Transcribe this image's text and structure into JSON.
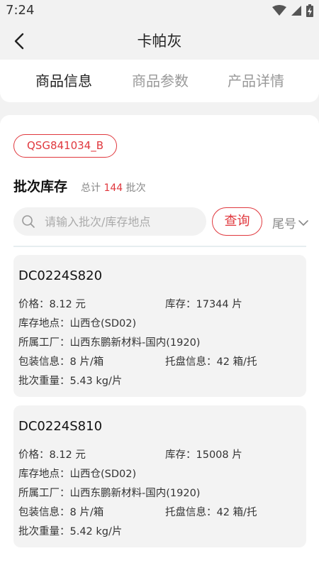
{
  "status_bar": {
    "time": "7:24"
  },
  "nav": {
    "title": "卡帕灰"
  },
  "tabs": [
    {
      "label": "商品信息",
      "active": true
    },
    {
      "label": "商品参数",
      "active": false
    },
    {
      "label": "产品详情",
      "active": false
    }
  ],
  "product": {
    "code": "QSG841034_B"
  },
  "batch_section": {
    "title": "批次库存",
    "total_prefix": "总计",
    "total_count": "144",
    "total_suffix": "批次"
  },
  "search": {
    "placeholder": "请输入批次/库存地点",
    "value": "",
    "query_label": "查询",
    "sort_label": "尾号"
  },
  "batches": [
    {
      "code": "DC0224S820",
      "price": "价格：8.12 元",
      "stock": "库存：17344 片",
      "location": "库存地点：山西仓(SD02)",
      "factory": "所属工厂：山西东鹏新材料-国内(1920)",
      "package": "包装信息：8 片/箱",
      "pallet": "托盘信息：42 箱/托",
      "weight": "批次重量：5.43 kg/片"
    },
    {
      "code": "DC0224S810",
      "price": "价格：8.12 元",
      "stock": "库存：15008 片",
      "location": "库存地点：山西仓(SD02)",
      "factory": "所属工厂：山西东鹏新材料-国内(1920)",
      "package": "包装信息：8 片/箱",
      "pallet": "托盘信息：42 箱/托",
      "weight": "批次重量：5.42 kg/片"
    }
  ],
  "colors": {
    "accent": "#e0383e",
    "muted": "#999999"
  }
}
